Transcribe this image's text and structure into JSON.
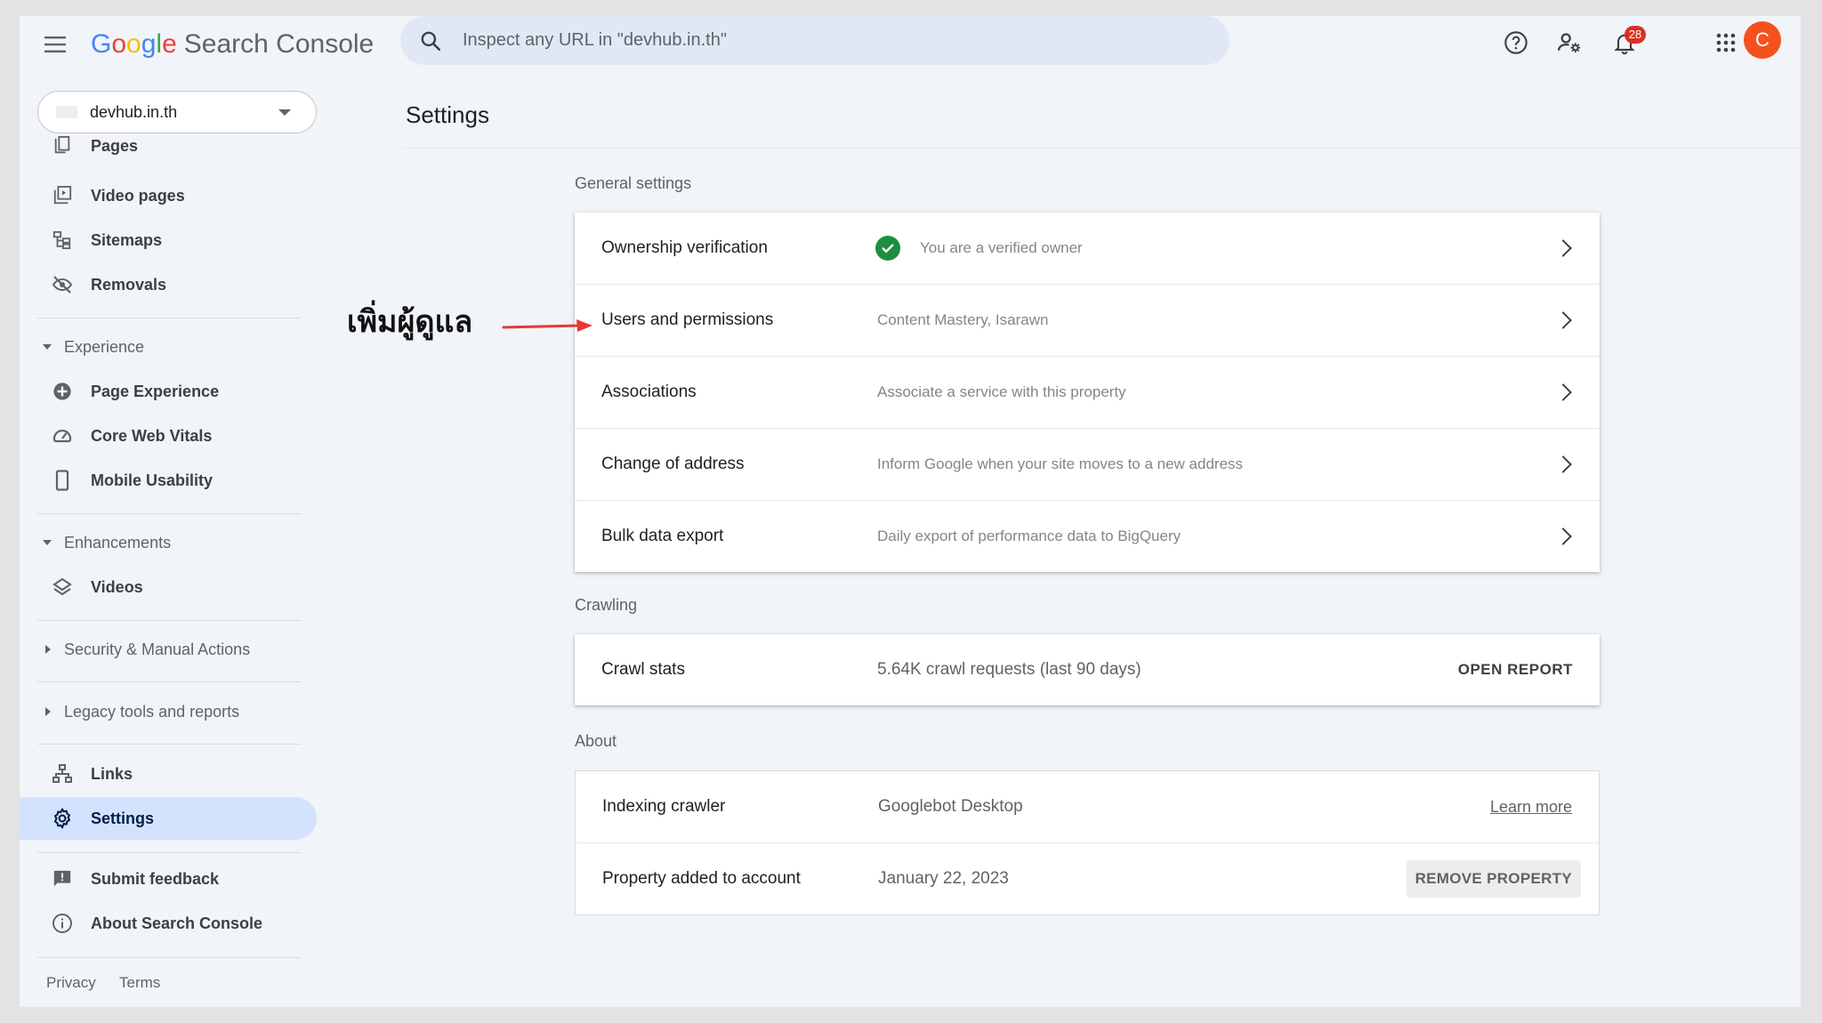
{
  "header": {
    "logo_parts": [
      "G",
      "o",
      "o",
      "g",
      "l",
      "e"
    ],
    "product_name": "Search Console",
    "search_placeholder": "Inspect any URL in \"devhub.in.th\"",
    "notification_count": "28",
    "avatar_letter": "C",
    "avatar_color": "#f4511e"
  },
  "sidebar": {
    "property": "devhub.in.th",
    "items": {
      "pages": "Pages",
      "video_pages": "Video pages",
      "sitemaps": "Sitemaps",
      "removals": "Removals",
      "page_experience": "Page Experience",
      "core_web_vitals": "Core Web Vitals",
      "mobile_usability": "Mobile Usability",
      "videos": "Videos",
      "links": "Links",
      "settings": "Settings",
      "submit_feedback": "Submit feedback",
      "about": "About Search Console"
    },
    "sections": {
      "experience": "Experience",
      "enhancements": "Enhancements",
      "security": "Security & Manual Actions",
      "legacy": "Legacy tools and reports"
    },
    "footer": {
      "privacy": "Privacy",
      "terms": "Terms"
    }
  },
  "main": {
    "title": "Settings",
    "general_label": "General settings",
    "general_rows": [
      {
        "label": "Ownership verification",
        "value": "You are a verified owner",
        "icon": "check-circle-icon"
      },
      {
        "label": "Users and permissions",
        "value": "Content Mastery, Isarawn"
      },
      {
        "label": "Associations",
        "value": "Associate a service with this property"
      },
      {
        "label": "Change of address",
        "value": "Inform Google when your site moves to a new address"
      },
      {
        "label": "Bulk data export",
        "value": "Daily export of performance data to BigQuery"
      }
    ],
    "crawling_label": "Crawling",
    "crawl_stats": {
      "label": "Crawl stats",
      "value": "5.64K crawl requests (last 90 days)",
      "action": "OPEN REPORT"
    },
    "about_label": "About",
    "indexing": {
      "label": "Indexing crawler",
      "value": "Googlebot Desktop",
      "link": "Learn more"
    },
    "property_added": {
      "label": "Property added to account",
      "value": "January 22, 2023",
      "action": "REMOVE PROPERTY"
    }
  },
  "annotation": {
    "text": "เพิ่มผู้ดูแล",
    "arrow_color": "#e53935"
  },
  "colors": {
    "active_nav_bg": "#d3e3fd",
    "verified_green": "#1e8e3e",
    "app_bg": "#f1f4f9"
  }
}
